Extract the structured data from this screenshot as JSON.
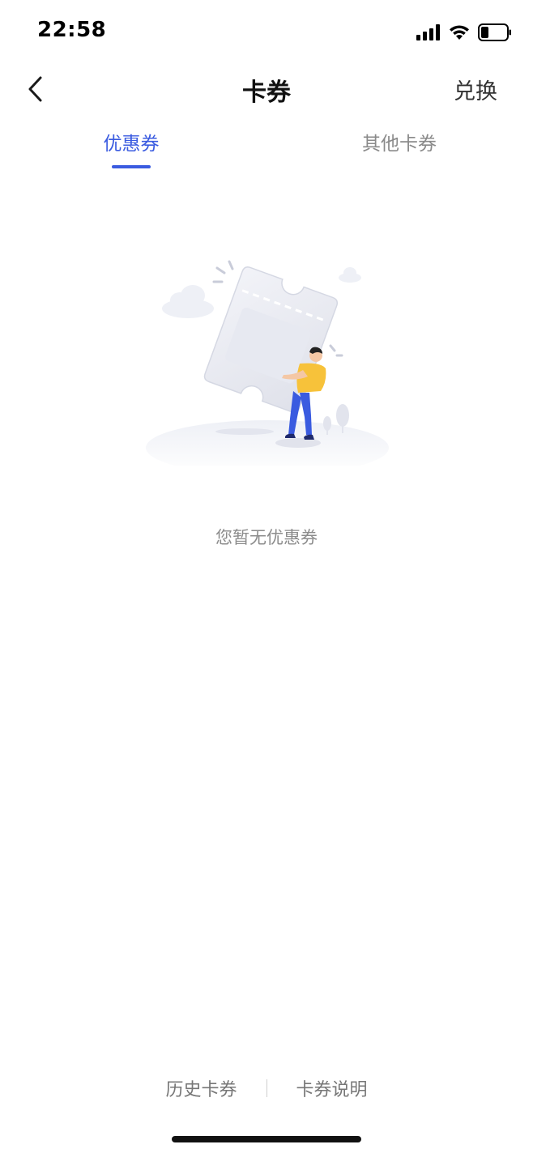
{
  "status_bar": {
    "time": "22:58",
    "icons": [
      "cellular-signal-icon",
      "wifi-icon",
      "battery-icon"
    ]
  },
  "nav": {
    "back_icon": "chevron-left-icon",
    "title": "卡券",
    "redeem_label": "兑换"
  },
  "tabs": [
    {
      "label": "优惠券",
      "active": true
    },
    {
      "label": "其他卡券",
      "active": false
    }
  ],
  "empty_state": {
    "illustration": "person-carrying-ticket-illustration",
    "message": "您暂无优惠券"
  },
  "footer": {
    "history_label": "历史卡券",
    "info_label": "卡券说明"
  },
  "colors": {
    "accent": "#3a5be0",
    "inactive_tab": "#8a8a8a",
    "muted_text": "#8c8c8c"
  }
}
